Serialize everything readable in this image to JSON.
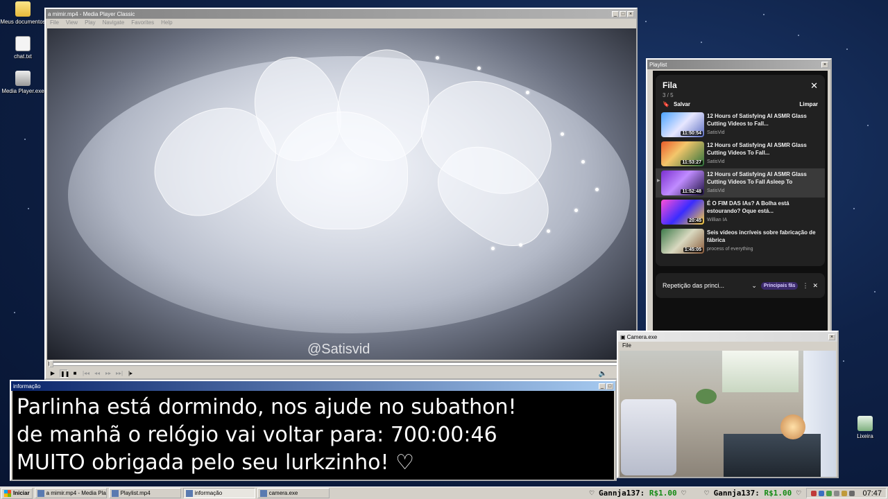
{
  "desktop": {
    "icons": [
      {
        "label": "Meus documentos",
        "icon": "folder-icon"
      },
      {
        "label": "chat.txt",
        "icon": "text-file-icon"
      },
      {
        "label": "Media Player.exe",
        "icon": "media-player-icon"
      },
      {
        "label": "Lixeira",
        "icon": "recycle-bin-icon"
      }
    ]
  },
  "player": {
    "title": "a mimir.mp4 - Media Player Classic",
    "menu": [
      "File",
      "View",
      "Play",
      "Navigate",
      "Favorites",
      "Help"
    ],
    "watermark": "@Satisvid",
    "progress": 0.0
  },
  "playlist": {
    "window_title": "Playlist",
    "queue_title": "Fila",
    "count": "3 / 5",
    "save_label": "Salvar",
    "clear_label": "Limpar",
    "items": [
      {
        "title": "12 Hours of Satisfying AI ASMR Glass Cutting Videos to Fall...",
        "channel": "SatisVid",
        "duration": "11:50:54",
        "current": false
      },
      {
        "title": "12 Hours of Satisfying AI ASMR Glass Cutting Videos To Fall...",
        "channel": "SatisVid",
        "duration": "11:53:27",
        "current": false
      },
      {
        "title": "12 Hours of Satisfying AI ASMR Glass Cutting Videos To Fall Asleep To",
        "channel": "SatisVid",
        "duration": "11:52:48",
        "current": true
      },
      {
        "title": "É O FIM DAS IAs? A Bolha está estourando? Oque está...",
        "channel": "Willian IA",
        "duration": "20:45",
        "current": false
      },
      {
        "title": "Seis vídeos incríveis sobre fabricação de fábrica",
        "channel": "process of everything",
        "duration": "1:45:05",
        "current": false
      }
    ],
    "repeat_label": "Repetição das princi...",
    "fans_badge": "Principais fãs"
  },
  "info": {
    "title": "informação",
    "lines": [
      "Parlinha está dormindo, nos ajude no subathon!",
      "de manhã o relógio vai voltar para:  700:00:46",
      "MUITO obrigada pelo seu lurkzinho! ♡"
    ]
  },
  "camera": {
    "title": "Camera.exe",
    "menu_file": "File"
  },
  "taskbar": {
    "start": "Iniciar",
    "tasks": [
      {
        "label": "a mimir.mp4 - Media Playe...",
        "active": false
      },
      {
        "label": "Playlist.mp4",
        "active": false
      },
      {
        "label": "informação",
        "active": true
      },
      {
        "label": "camera.exe",
        "active": false
      }
    ],
    "ticker_name": "Gannja137:",
    "ticker_amount": "R$1.00",
    "clock": "07:47"
  },
  "colors": {
    "title_active": "#0a246a",
    "title_inactive": "#808080",
    "ticker_amount": "#138a13",
    "yt_bg": "#0f0f0f"
  }
}
